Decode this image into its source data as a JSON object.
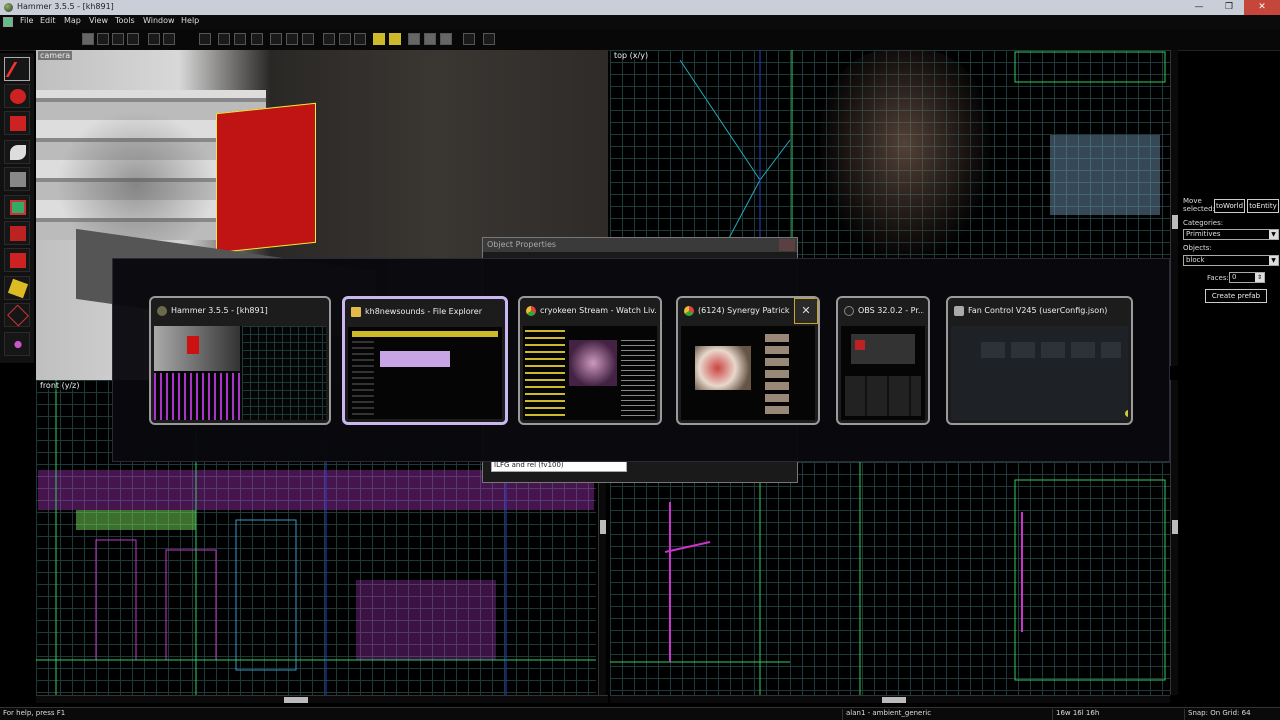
{
  "window": {
    "title": "Hammer 3.5.5 - [kh891]",
    "minimize": "—",
    "maximize": "❐",
    "close": "✕"
  },
  "menu": [
    "File",
    "Edit",
    "Map",
    "View",
    "Tools",
    "Window",
    "Help"
  ],
  "viewports": {
    "camera": "camera",
    "top": "top (x/y)",
    "front": "front (y/z)"
  },
  "right_panel": {
    "move_selected": "Move selected:",
    "to_world": "toWorld",
    "to_entity": "toEntity",
    "categories_label": "Categories:",
    "categories_value": "Primitives",
    "objects_label": "Objects:",
    "objects_value": "block",
    "faces_label": "Faces:",
    "faces_value": "0",
    "create_prefab": "Create prefab"
  },
  "object_properties": {
    "title": "Object Properties",
    "field": "ILFG and rel (fv100)"
  },
  "switcher": {
    "cards": [
      {
        "title": "Hammer 3.5.5 - [kh891]",
        "icon_color": "#6b6b4a"
      },
      {
        "title": "kh8newsounds - File Explorer",
        "icon_color": "#e4b84a"
      },
      {
        "title": "cryokeen Stream - Watch Liv...",
        "icon_color": "#d44"
      },
      {
        "title": "(6124) Synergy Patrick...",
        "icon_color": "#3a8ee6"
      },
      {
        "title": "OBS 32.0.2 - Pr...",
        "icon_color": "#888"
      },
      {
        "title": "Fan Control V245 (userConfig.json)",
        "icon_color": "#aaa"
      }
    ],
    "close_symbol": "✕"
  },
  "status": {
    "help": "For help, press F1",
    "entity": "alan1 - ambient_generic",
    "size": "16w 16l 16h",
    "snap": "Snap: On Grid: 64"
  }
}
